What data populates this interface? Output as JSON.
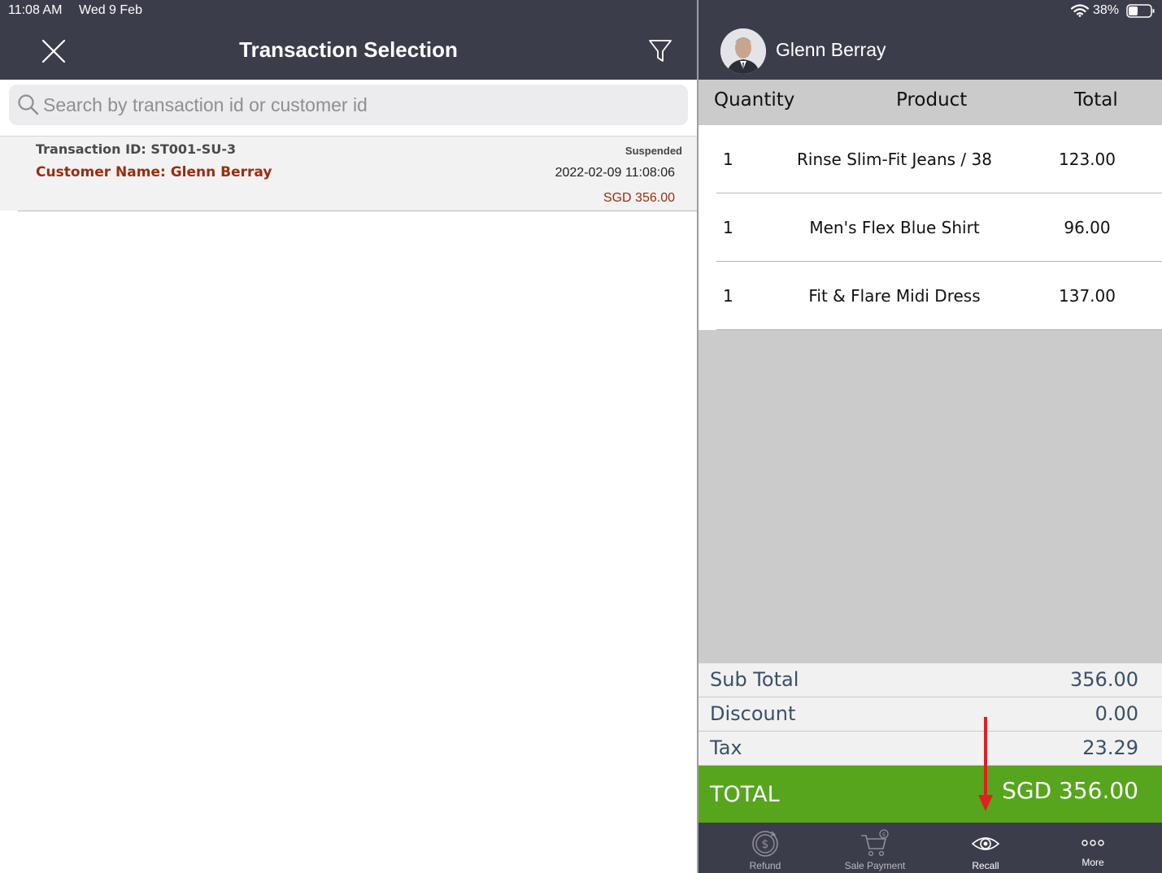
{
  "status_bar": {
    "time": "11:08 AM",
    "date": "Wed 9 Feb",
    "battery": "38%"
  },
  "left_panel": {
    "title": "Transaction Selection",
    "search": {
      "placeholder": "Search by transaction id or customer id",
      "value": ""
    },
    "transactions": [
      {
        "id_label": "Transaction ID: ST001-SU-3",
        "customer_label": "Customer Name: Glenn Berray",
        "status": "Suspended",
        "datetime": "2022-02-09 11:08:06",
        "amount": "SGD 356.00"
      }
    ]
  },
  "right_panel": {
    "customer_name": "Glenn Berray",
    "columns": {
      "quantity": "Quantity",
      "product": "Product",
      "total": "Total"
    },
    "items": [
      {
        "qty": "1",
        "product": "Rinse Slim-Fit Jeans / 38",
        "total": "123.00"
      },
      {
        "qty": "1",
        "product": "Men's Flex Blue Shirt",
        "total": "96.00"
      },
      {
        "qty": "1",
        "product": "Fit & Flare Midi Dress",
        "total": "137.00"
      }
    ],
    "summary": {
      "subtotal_label": "Sub Total",
      "subtotal": "356.00",
      "discount_label": "Discount",
      "discount": "0.00",
      "tax_label": "Tax",
      "tax": "23.29",
      "total_label": "TOTAL",
      "total": "SGD 356.00"
    },
    "bottom_nav": {
      "refund": "Refund",
      "sale_payment": "Sale Payment",
      "recall": "Recall",
      "more": "More"
    }
  },
  "colors": {
    "header_bg": "#3c3d4b",
    "accent_red": "#9a2d10",
    "total_green": "#57a51d",
    "summary_text": "#3b4f69",
    "annotation_arrow": "#e02020"
  },
  "icons": [
    "close-icon",
    "filter-icon",
    "search-icon",
    "wifi-icon",
    "battery-icon",
    "refund-icon",
    "sale-payment-icon",
    "recall-icon",
    "more-icon"
  ]
}
